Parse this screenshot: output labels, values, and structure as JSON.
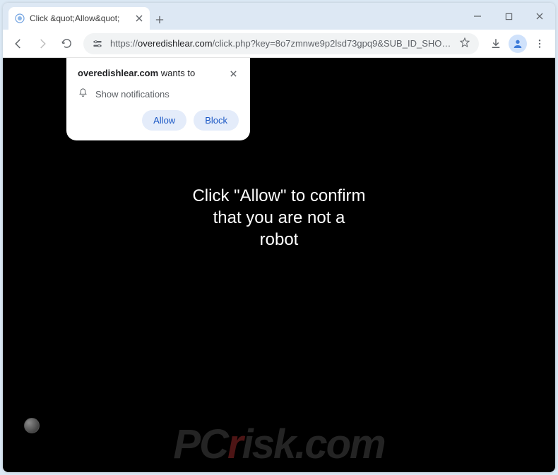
{
  "window": {
    "tab_title": "Click &quot;Allow&quot;"
  },
  "url": {
    "protocol": "https://",
    "host": "overedishlear.com",
    "path": "/click.php?key=8o7zmnwe9p2lsd73gpq9&SUB_ID_SHORT=46eed525d2b64056266fe6a..."
  },
  "notification": {
    "site": "overedishlear.com",
    "wants_to": " wants to",
    "permission_label": "Show notifications",
    "allow_label": "Allow",
    "block_label": "Block"
  },
  "page": {
    "message": "Click \"Allow\" to confirm\nthat you are not a\nrobot"
  },
  "watermark": {
    "prefix": "PC",
    "r": "r",
    "suffix": "isk.com"
  }
}
